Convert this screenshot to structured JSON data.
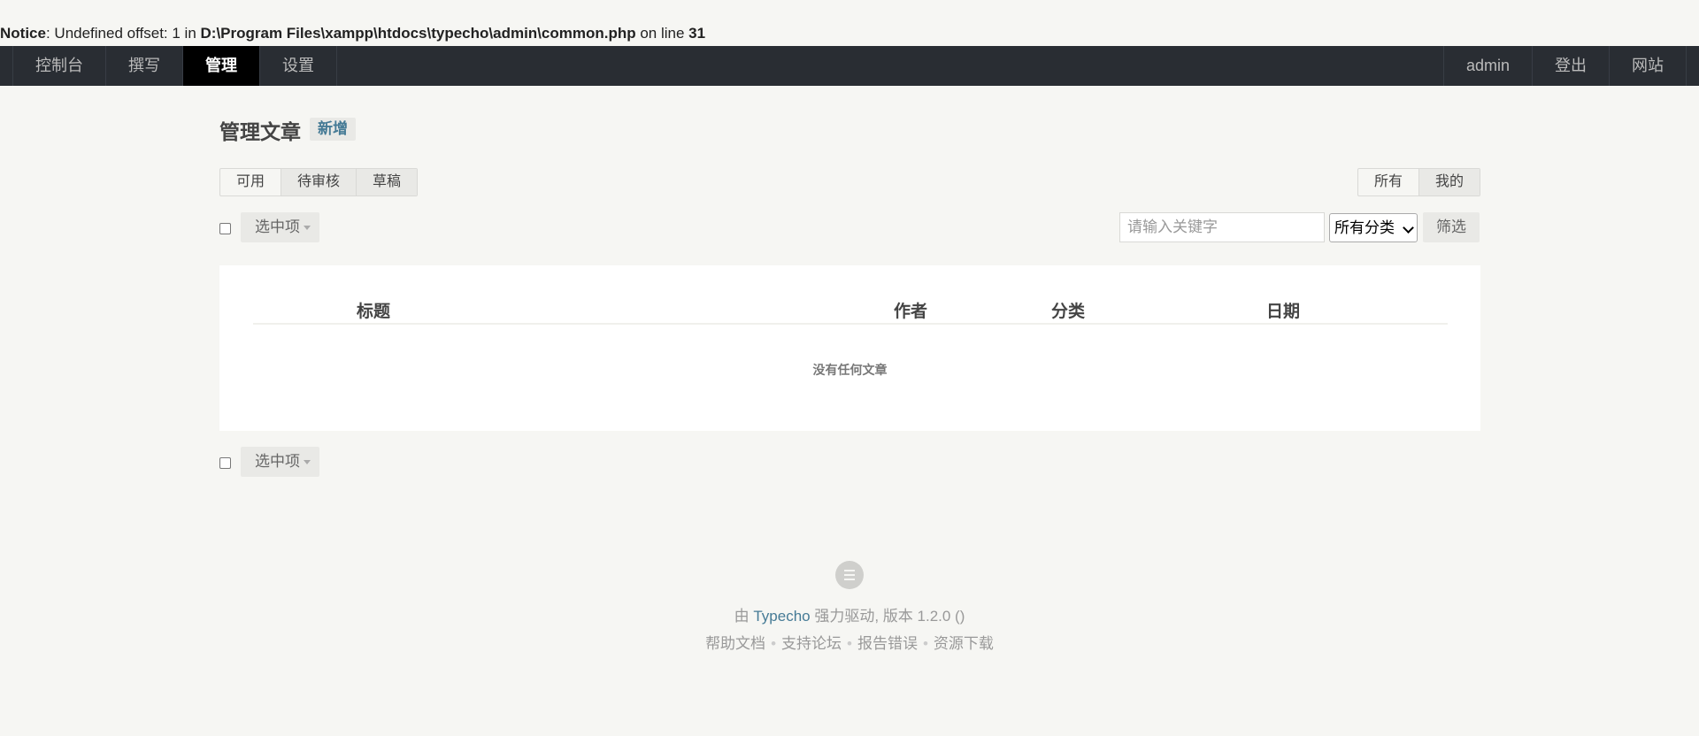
{
  "notice": {
    "label": "Notice",
    "text_before": ": Undefined offset: 1 in ",
    "path": "D:\\Program Files\\xampp\\htdocs\\typecho\\admin\\common.php",
    "text_mid": " on line ",
    "line": "31"
  },
  "topnav": {
    "left_items": [
      "控制台",
      "撰写",
      "管理",
      "设置"
    ],
    "active_item": "管理",
    "right_items": [
      "admin",
      "登出",
      "网站"
    ]
  },
  "main": {
    "title": "管理文章",
    "add_label": "新增",
    "status_tabs": [
      "可用",
      "待审核",
      "草稿"
    ],
    "status_tabs_highlighted": [
      "待审核",
      "草稿"
    ],
    "scope_tabs": [
      "所有",
      "我的"
    ],
    "scope_tabs_highlighted": [
      "我的"
    ],
    "selection_label": "选中项",
    "search_placeholder": "请输入关键字",
    "category_select": "所有分类",
    "filter_label": "筛选",
    "table": {
      "columns": [
        "标题",
        "作者",
        "分类",
        "日期"
      ],
      "empty_message": "没有任何文章"
    }
  },
  "footer": {
    "line1_prefix": "由 ",
    "brand": "Typecho",
    "line1_suffix": " 强力驱动, 版本 1.2.0 ()",
    "links": [
      "帮助文档",
      "支持论坛",
      "报告错误",
      "资源下载"
    ]
  },
  "colors": {
    "page_bg": "#f6f6f3",
    "nav_bg": "#292d33",
    "nav_active_bg": "#000000",
    "accent": "#467b96"
  }
}
